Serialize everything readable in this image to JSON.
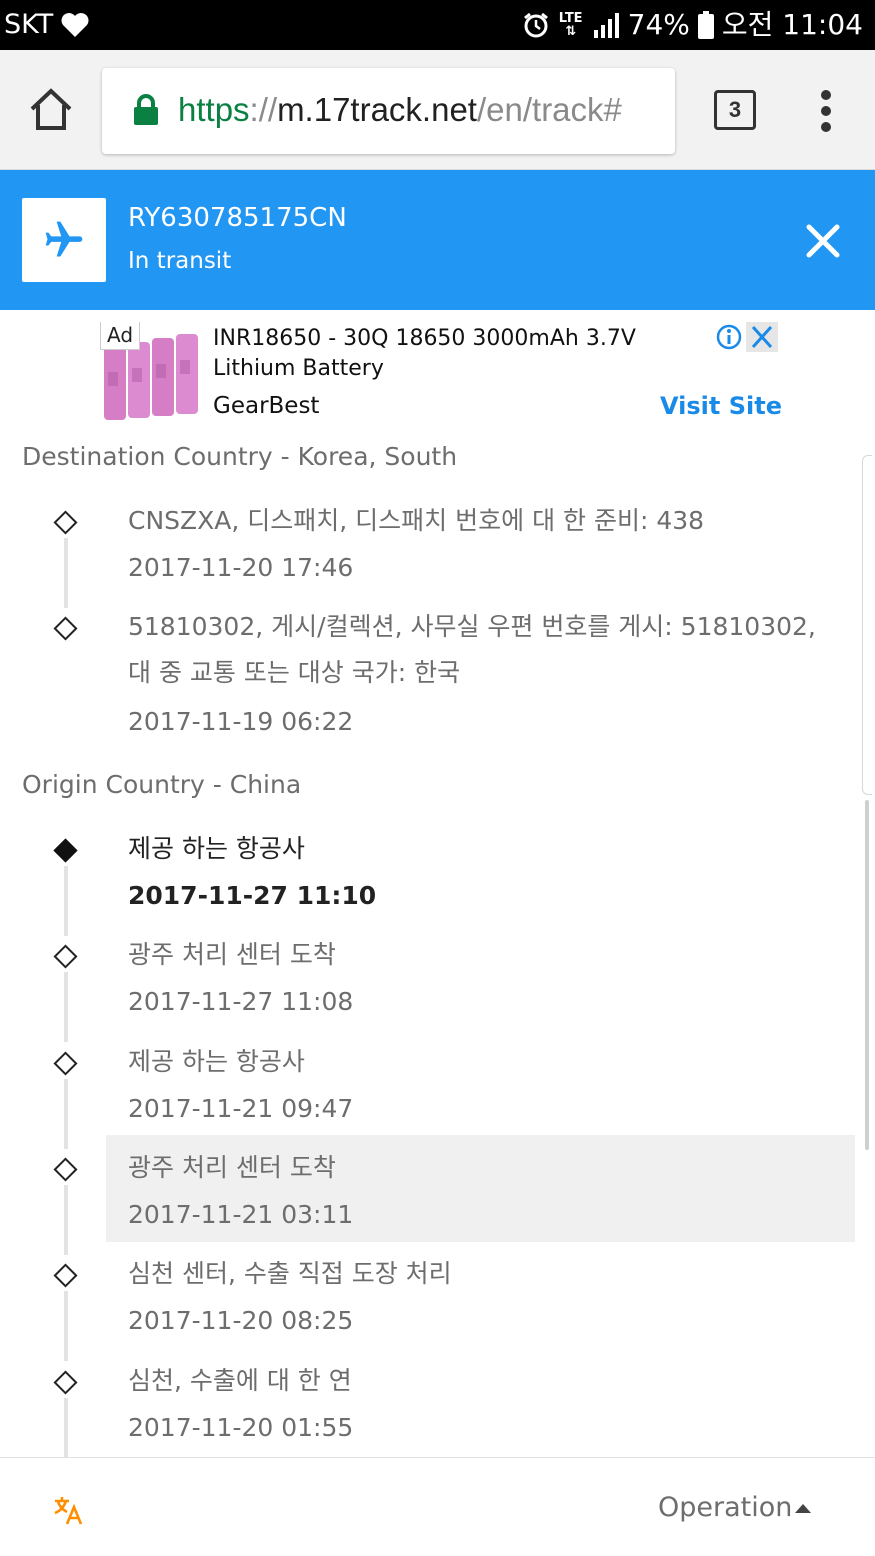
{
  "status_bar": {
    "carrier": "SKT",
    "lte": "LTE",
    "battery": "74%",
    "time": "오전 11:04"
  },
  "browser": {
    "url_scheme": "https",
    "url_separator": "://",
    "url_host": "m.17track.net",
    "url_path": "/en/track#",
    "tab_count": "3"
  },
  "tracking": {
    "number": "RY630785175CN",
    "status": "In transit",
    "header_color": "#2196f3"
  },
  "ad": {
    "badge": "Ad",
    "title": "INR18650 - 30Q 18650 3000mAh 3.7V Lithium Battery",
    "advertiser": "GearBest",
    "cta": "Visit Site"
  },
  "destination": {
    "title": "Destination Country - Korea, South",
    "events": [
      {
        "desc": "CNSZXA, 디스패치, 디스패치 번호에 대 한 준비: 438",
        "time": "2017-11-20 17:46"
      },
      {
        "desc": "51810302, 게시/컬렉션, 사무실 우편 번호를 게시: 51810302, 대 중 교통 또는 대상 국가: 한국",
        "time": "2017-11-19 06:22"
      }
    ]
  },
  "origin": {
    "title": "Origin Country - China",
    "events": [
      {
        "desc": "제공 하는 항공사",
        "time": "2017-11-27 11:10"
      },
      {
        "desc": "광주 처리 센터 도착",
        "time": "2017-11-27 11:08"
      },
      {
        "desc": "제공 하는 항공사",
        "time": "2017-11-21 09:47"
      },
      {
        "desc": "광주 처리 센터 도착",
        "time": "2017-11-21 03:11"
      },
      {
        "desc": "심천 센터, 수출 직접 도장 처리",
        "time": "2017-11-20 08:25"
      },
      {
        "desc": "심천, 수출에 대 한 연",
        "time": "2017-11-20 01:55"
      }
    ]
  },
  "bottom_bar": {
    "operation_label": "Operation",
    "translate_icon": "translate-icon",
    "accent_color": "#ff8f00"
  }
}
